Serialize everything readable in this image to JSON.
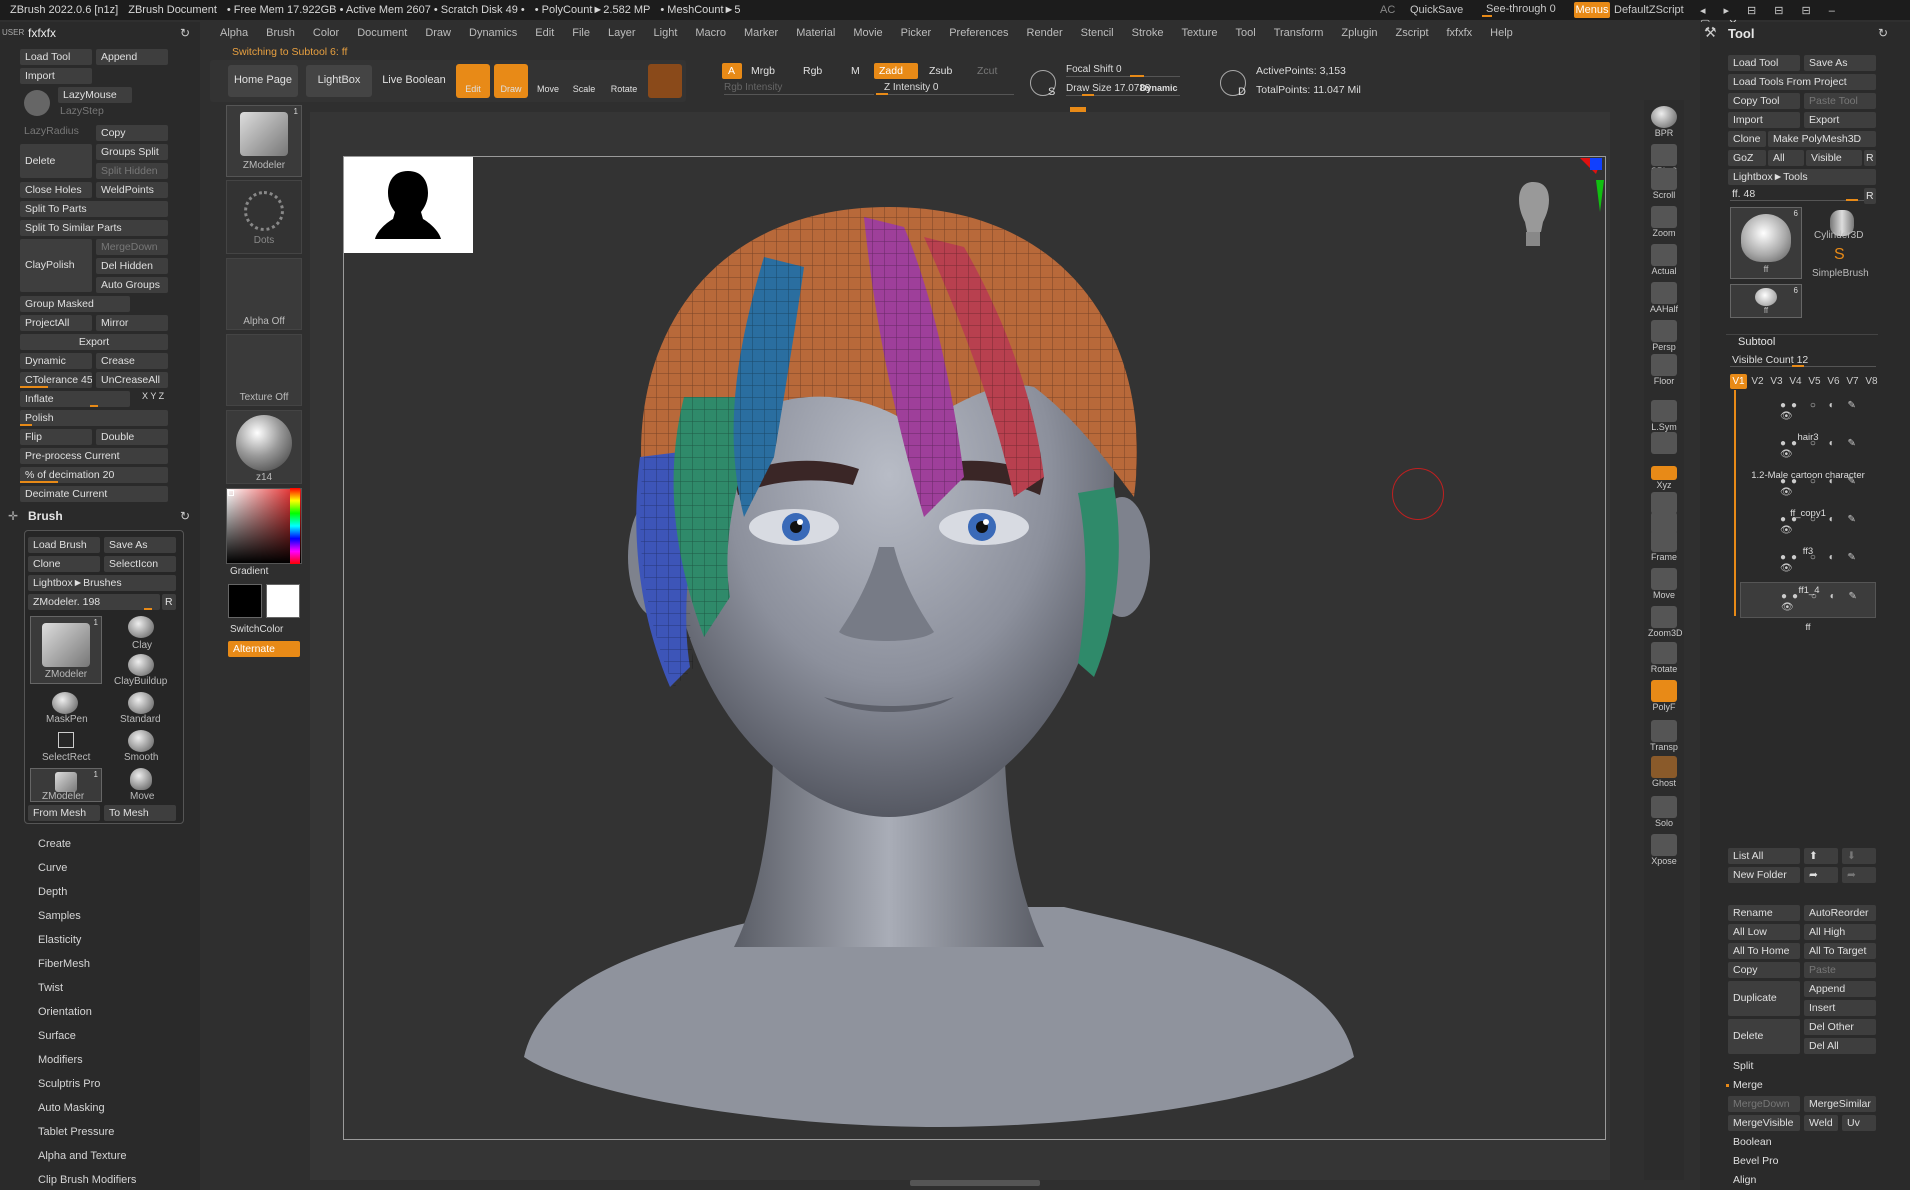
{
  "titlebar": {
    "app": "ZBrush 2022.0.6 [n1z]",
    "doc": "ZBrush Document",
    "freemem": "• Free Mem 17.922GB • Active Mem 2607 • Scratch Disk 49 •",
    "poly": "• PolyCount►2.582 MP",
    "mesh": "• MeshCount►5",
    "ac": "AC",
    "quicksave": "QuickSave",
    "seethrough": "See-through  0",
    "menus": "Menus",
    "script": "DefaultZScript"
  },
  "menubar": [
    "Alpha",
    "Brush",
    "Color",
    "Document",
    "Draw",
    "Dynamics",
    "Edit",
    "File",
    "Layer",
    "Light",
    "Macro",
    "Marker",
    "Material",
    "Movie",
    "Picker",
    "Preferences",
    "Render",
    "Stencil",
    "Stroke",
    "Texture",
    "Tool",
    "Transform",
    "Zplugin",
    "Zscript",
    "fxfxfx",
    "Help"
  ],
  "status": {
    "switching": "Switching to Subtool 6:  ff"
  },
  "left": {
    "user": "USER",
    "title": "fxfxfx",
    "buttons": {
      "load_tool": "Load Tool",
      "append": "Append",
      "import": "Import",
      "lazymouse": "LazyMouse",
      "lazystep": "LazyStep",
      "lazyradius": "LazyRadius",
      "copy": "Copy",
      "delete": "Delete",
      "groups_split": "Groups Split",
      "split_hidden": "Split Hidden",
      "close_holes": "Close Holes",
      "weldpoints": "WeldPoints",
      "split_to_parts": "Split To Parts",
      "split_to_similar": "Split To Similar Parts",
      "claypolish": "ClayPolish",
      "mergedown": "MergeDown",
      "del_hidden": "Del Hidden",
      "auto_groups": "Auto Groups",
      "group_masked": "Group Masked",
      "projectall": "ProjectAll",
      "mirror": "Mirror",
      "export": "Export",
      "dynamic": "Dynamic",
      "crease": "Crease",
      "ctolerance": "CTolerance 45",
      "uncreaseall": "UnCreaseAll",
      "inflate": "Inflate",
      "xyz": "X Y Z",
      "polish": "Polish",
      "flip": "Flip",
      "double": "Double",
      "preprocess": "Pre-process Current",
      "decimation": "% of decimation 20",
      "decimate": "Decimate Current"
    },
    "brush_title": "Brush",
    "brush": {
      "load_brush": "Load Brush",
      "save_as": "Save As",
      "clone": "Clone",
      "selecticon": "SelectIcon",
      "lightbox": "Lightbox►Brushes",
      "zmodeler": "ZModeler. 198",
      "r": "R",
      "b1": "ZModeler",
      "b2": "Clay",
      "b3": "ClayBuildup",
      "b4": "MaskPen",
      "b5": "Standard",
      "b6": "SelectRect",
      "b7": "Smooth",
      "b8": "ZModeler",
      "b9": "Move",
      "from_mesh": "From Mesh",
      "to_mesh": "To Mesh",
      "one": "1"
    },
    "menu": [
      "Create",
      "Curve",
      "Depth",
      "Samples",
      "Elasticity",
      "FiberMesh",
      "Twist",
      "Orientation",
      "Surface",
      "Modifiers",
      "Sculptris Pro",
      "Auto Masking",
      "Tablet Pressure",
      "Alpha and Texture",
      "Clip Brush Modifiers"
    ]
  },
  "palette": {
    "zmodeler": "ZModeler",
    "dots": "Dots",
    "alpha_off": "Alpha Off",
    "texture_off": "Texture Off",
    "z14": "z14",
    "gradient": "Gradient",
    "switchcolor": "SwitchColor",
    "alternate": "Alternate",
    "one": "1"
  },
  "toolbar": {
    "home": "Home Page",
    "lightbox": "LightBox",
    "live_boolean": "Live Boolean",
    "edit": "Edit",
    "draw": "Draw",
    "move": "Move",
    "scale": "Scale",
    "rotate": "Rotate",
    "a": "A",
    "mrgb": "Mrgb",
    "rgb": "Rgb",
    "m": "M",
    "zadd": "Zadd",
    "zsub": "Zsub",
    "zcut": "Zcut",
    "rgb_int": "Rgb Intensity",
    "z_int": "Z Intensity 0",
    "focal": "Focal Shift 0",
    "draw_size": "Draw Size 17.0788",
    "dynamic": "Dynamic",
    "active_points": "ActivePoints: 3,153",
    "total_points": "TotalPoints: 11.047 Mil",
    "s": "S",
    "d": "D"
  },
  "shelf": [
    "BPR",
    "SPix 3",
    "Scroll",
    "Zoom",
    "Actual",
    "AAHalf",
    "Persp",
    "Floor",
    "L.Sym",
    "",
    "Xyz",
    "",
    "",
    "Frame",
    "Move",
    "Zoom3D",
    "Rotate",
    "PolyF",
    "Transp",
    "Ghost",
    "Solo",
    "Xpose"
  ],
  "tool": {
    "title": "Tool",
    "load_tool": "Load Tool",
    "save_as": "Save As",
    "load_from_project": "Load Tools From Project",
    "copy_tool": "Copy Tool",
    "paste_tool": "Paste Tool",
    "import": "Import",
    "export": "Export",
    "clone": "Clone",
    "make_polymesh": "Make PolyMesh3D",
    "goz": "GoZ",
    "all": "All",
    "visible": "Visible",
    "r": "R",
    "lightbox_tools": "Lightbox►Tools",
    "ff48": "ff. 48",
    "thumb1": "ff",
    "thumb1_count": "6",
    "cylinder": "Cylinder3D",
    "simplebrush": "SimpleBrush",
    "thumb2": "ff",
    "thumb2_count": "6",
    "subtool": "Subtool",
    "visible_count": "Visible Count 12",
    "versions": [
      "V1",
      "V2",
      "V3",
      "V4",
      "V5",
      "V6",
      "V7",
      "V8"
    ],
    "subtools": [
      "",
      "hair3",
      "1.2-Male cartoon character",
      "ff_copy1",
      "ff3",
      "ff1_4",
      "ff"
    ],
    "list_all": "List All",
    "new_folder": "New Folder",
    "rename": "Rename",
    "autoreorder": "AutoReorder",
    "all_low": "All Low",
    "all_high": "All High",
    "all_to_home": "All To Home",
    "all_to_target": "All To Target",
    "copy": "Copy",
    "paste": "Paste",
    "duplicate": "Duplicate",
    "append": "Append",
    "insert": "Insert",
    "delete": "Delete",
    "del_other": "Del Other",
    "del_all": "Del All",
    "split": "Split",
    "merge": "Merge",
    "mergedown": "MergeDown",
    "mergesimilar": "MergeSimilar",
    "mergevisible": "MergeVisible",
    "weld": "Weld",
    "uv": "Uv",
    "boolean": "Boolean",
    "bevel_pro": "Bevel Pro",
    "align": "Align"
  }
}
